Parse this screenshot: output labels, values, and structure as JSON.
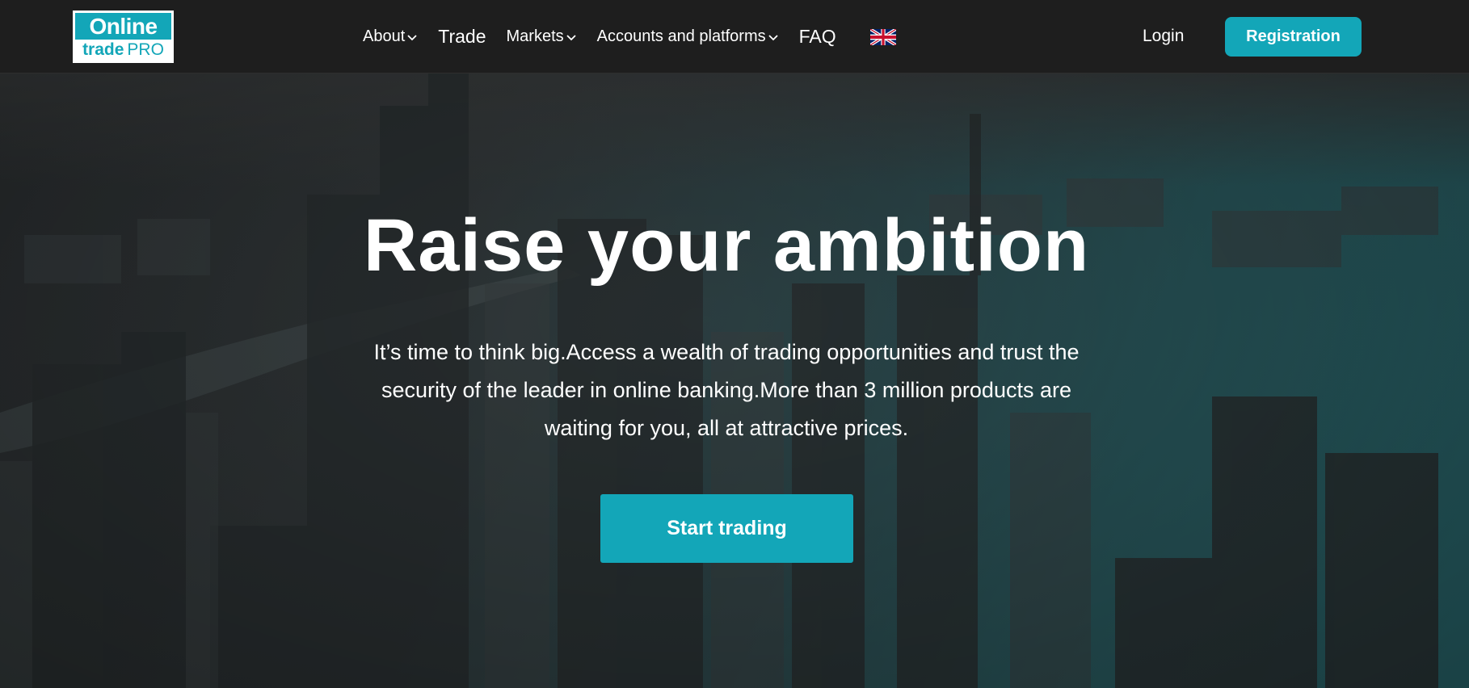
{
  "logo": {
    "line1": "Online",
    "line2": "trade",
    "line2_suffix": "PRO"
  },
  "nav": {
    "items": [
      {
        "label": "About",
        "dropdown": true
      },
      {
        "label": "Trade",
        "dropdown": false
      },
      {
        "label": "Markets",
        "dropdown": true
      },
      {
        "label": "Accounts and platforms",
        "dropdown": true
      },
      {
        "label": "FAQ",
        "dropdown": false
      }
    ],
    "language_flag_icon": "uk-flag-icon"
  },
  "header": {
    "login_label": "Login",
    "registration_label": "Registration"
  },
  "hero": {
    "title": "Raise your ambition",
    "text_lines": [
      "It’s time to think big.Access a wealth of trading opportunities and trust the",
      "security of the leader in online banking.More than 3 million products are",
      "waiting for you, all at attractive prices."
    ],
    "cta_label": "Start trading"
  },
  "colors": {
    "accent": "#13a6b8",
    "header_bg": "#1e1e1e",
    "text": "#ffffff"
  }
}
